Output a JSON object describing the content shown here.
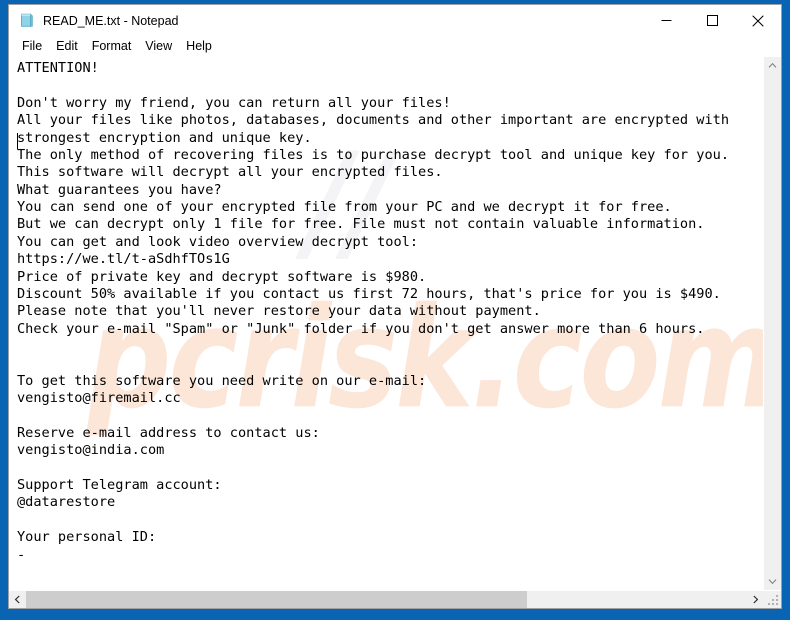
{
  "window": {
    "title": "READ_ME.txt - Notepad",
    "icon": "notepad-document-icon",
    "frame_color": "#0a64b4",
    "background_color": "#ffffff"
  },
  "title_bar": {
    "minimize_label": "Minimize",
    "maximize_label": "Maximize",
    "close_label": "Close"
  },
  "menu_bar": {
    "items": [
      {
        "label": "File"
      },
      {
        "label": "Edit"
      },
      {
        "label": "Format"
      },
      {
        "label": "View"
      },
      {
        "label": "Help"
      }
    ]
  },
  "document": {
    "filename": "READ_ME.txt",
    "caret_line": 5,
    "caret_column": 1,
    "body": "ATTENTION!\n\nDon't worry my friend, you can return all your files!\nAll your files like photos, databases, documents and other important are encrypted with\nstrongest encryption and unique key.\nThe only method of recovering files is to purchase decrypt tool and unique key for you.\nThis software will decrypt all your encrypted files.\nWhat guarantees you have?\nYou can send one of your encrypted file from your PC and we decrypt it for free.\nBut we can decrypt only 1 file for free. File must not contain valuable information.\nYou can get and look video overview decrypt tool:\nhttps://we.tl/t-aSdhfTOs1G\nPrice of private key and decrypt software is $980.\nDiscount 50% available if you contact us first 72 hours, that's price for you is $490.\nPlease note that you'll never restore your data without payment.\nCheck your e-mail \"Spam\" or \"Junk\" folder if you don't get answer more than 6 hours.\n\n\nTo get this software you need write on our e-mail:\nvengisto@firemail.cc\n\nReserve e-mail address to contact us:\nvengisto@india.com\n\nSupport Telegram account:\n@datarestore\n\nYour personal ID:\n-",
    "ransom_details": {
      "price_full": "$980",
      "price_discounted": "$490",
      "discount_percent": "50%",
      "discount_window_hours": "72",
      "reply_wait_hours": "6",
      "free_decrypt_files": "1",
      "video_overview_url": "https://we.tl/t-aSdhfTOs1G",
      "primary_email": "vengisto@firemail.cc",
      "reserve_email": "vengisto@india.com",
      "telegram_account": "@datarestore",
      "personal_id": "-"
    }
  },
  "scrollbars": {
    "vertical": {
      "up_arrow": "chevron-up-icon",
      "down_arrow": "chevron-down-icon",
      "thumb_visible": false
    },
    "horizontal": {
      "left_arrow": "chevron-left-icon",
      "right_arrow": "chevron-right-icon",
      "thumb_percent": "69.5"
    },
    "resize_grip": "resize-grip-icon"
  },
  "watermark": {
    "text": "pcrisk.com",
    "color": "#fbe2d2"
  }
}
